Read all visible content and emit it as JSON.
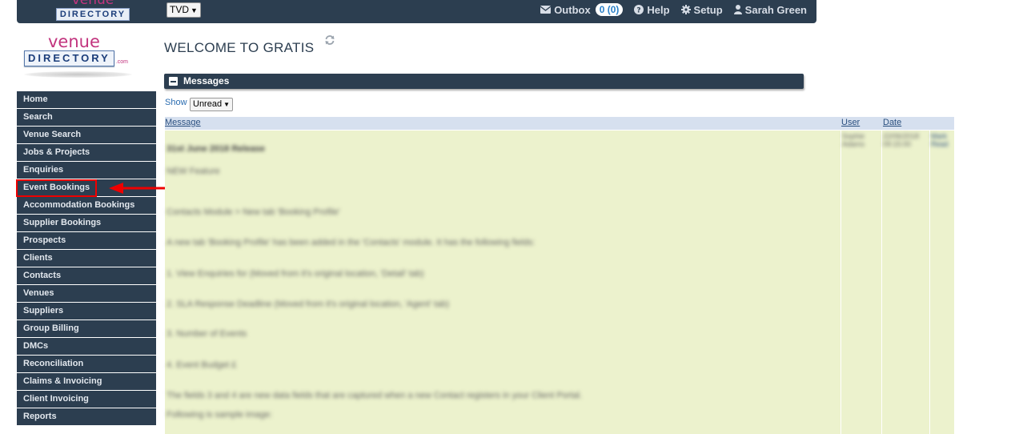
{
  "topbar": {
    "logo_top": "venue",
    "logo_bottom": "DIRECTORY",
    "account_select": "TVD",
    "outbox_label": "Outbox",
    "outbox_count": "0 (0)",
    "help_label": "Help",
    "setup_label": "Setup",
    "user_name": "Sarah Green"
  },
  "sidebar_logo": {
    "top": "venue",
    "bottom": "DIRECTORY",
    "suffix": ".com"
  },
  "sidebar": {
    "items": [
      {
        "label": "Home"
      },
      {
        "label": "Search"
      },
      {
        "label": "Venue Search"
      },
      {
        "label": "Jobs & Projects"
      },
      {
        "label": "Enquiries"
      },
      {
        "label": "Event Bookings"
      },
      {
        "label": "Accommodation Bookings"
      },
      {
        "label": "Supplier Bookings"
      },
      {
        "label": "Prospects"
      },
      {
        "label": "Clients"
      },
      {
        "label": "Contacts"
      },
      {
        "label": "Venues"
      },
      {
        "label": "Suppliers"
      },
      {
        "label": "Group Billing"
      },
      {
        "label": "DMCs"
      },
      {
        "label": "Reconciliation"
      },
      {
        "label": "Claims & Invoicing"
      },
      {
        "label": "Client Invoicing"
      },
      {
        "label": "Reports"
      }
    ]
  },
  "main": {
    "title": "WELCOME TO GRATIS",
    "panel_title": "Messages",
    "show_label": "Show",
    "show_filter": "Unread",
    "columns": {
      "message": "Message",
      "user": "User",
      "date": "Date"
    },
    "message_lines": [
      "31st June 2018 Release",
      "NEW Feature",
      "Contacts Module > New tab 'Booking Profile'",
      "A new tab 'Booking Profile' has been added in the 'Contacts' module. It has the following fields:",
      "1. View Enquiries for (Moved from it's original location, 'Detail' tab)",
      "2. SLA Response Deadline (Moved from it's original location, 'Agent' tab)",
      "3. Number of Events",
      "4. Event Budget £",
      "The fields 3 and 4 are new data fields that are captured when a new Contact registers in your Client Portal.",
      "Following is sample image:"
    ],
    "row_user": "Sophie Adams",
    "row_date": "22/06/2018 09:15:00",
    "row_action": "Mark Read"
  }
}
